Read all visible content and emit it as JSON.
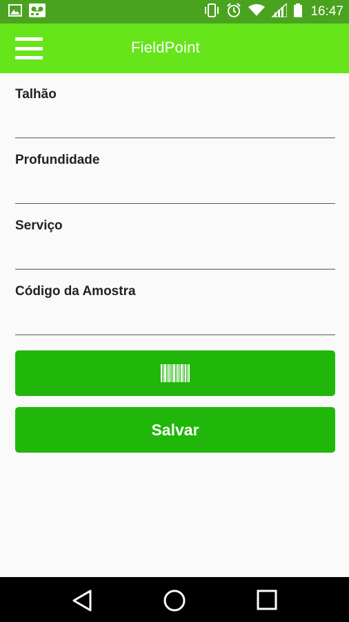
{
  "status_bar": {
    "time": "16:47",
    "icons_left": [
      "image-icon",
      "voicemail-icon"
    ],
    "icons_right": [
      "vibrate-icon",
      "alarm-icon",
      "wifi-icon",
      "signal-icon",
      "battery-icon"
    ]
  },
  "app_bar": {
    "title": "FieldPoint",
    "color": "#66e51b"
  },
  "form": {
    "fields": [
      {
        "label": "Talhão",
        "value": ""
      },
      {
        "label": "Profundidade",
        "value": ""
      },
      {
        "label": "Serviço",
        "value": ""
      },
      {
        "label": "Código da Amostra",
        "value": ""
      }
    ]
  },
  "buttons": {
    "scan_icon": "barcode-icon",
    "save_label": "Salvar",
    "color": "#20b70a"
  },
  "nav_bar": {
    "icons": [
      "back-icon",
      "home-icon",
      "recents-icon"
    ]
  }
}
